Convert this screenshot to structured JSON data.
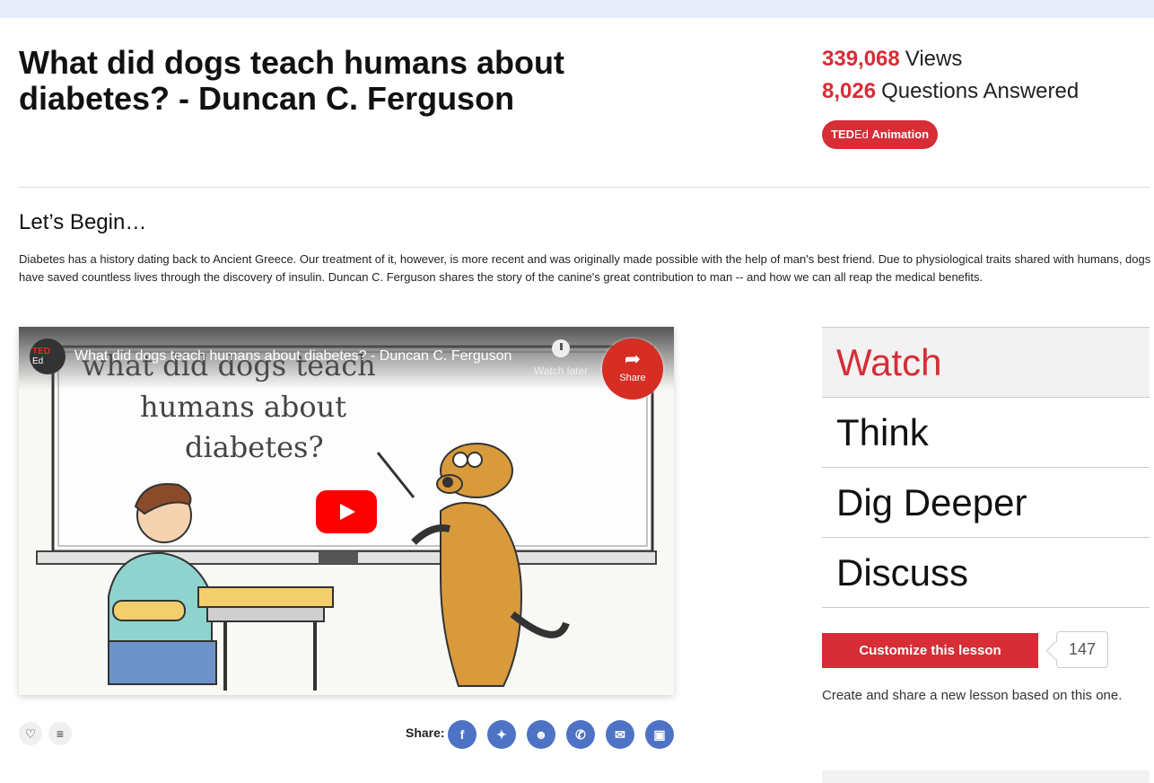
{
  "lesson": {
    "title": "What did dogs teach humans about diabetes? - Duncan C. Ferguson",
    "views_count": "339,068",
    "views_label": "Views",
    "answers_count": "8,026",
    "answers_label": "Questions Answered",
    "badge": {
      "ted": "TED",
      "ed": "Ed",
      "type": "Animation"
    }
  },
  "intro": {
    "heading": "Let’s Begin…",
    "description": "Diabetes has a history dating back to Ancient Greece. Our treatment of it, however, is more recent and was originally made possible with the help of man's best friend. Due to physiological traits shared with humans, dogs have saved countless lives through the discovery of insulin. Duncan C. Ferguson shares the story of the canine's great contribution to man -- and how we can all reap the medical benefits."
  },
  "video": {
    "channel_top": "TED",
    "channel_bottom": "Ed",
    "title": "What did dogs teach humans about diabetes? - Duncan C. Ferguson",
    "watch_later": "Watch later",
    "share": "Share",
    "chalkboard": [
      "what did dogs teach",
      "humans about",
      "diabetes?"
    ]
  },
  "actions": {
    "share_label": "Share:",
    "networks": [
      "facebook-icon",
      "twitter-icon",
      "reddit-icon",
      "whatsapp-icon",
      "email-icon",
      "classroom-icon"
    ]
  },
  "lesson_nav": [
    "Watch",
    "Think",
    "Dig Deeper",
    "Discuss"
  ],
  "customize": {
    "button": "Customize this lesson",
    "count": "147",
    "note": "Create and share a new lesson based on this one."
  },
  "colors": {
    "accent": "#d62d36",
    "social": "#4e73c5",
    "topbar": "#e8eef9"
  }
}
